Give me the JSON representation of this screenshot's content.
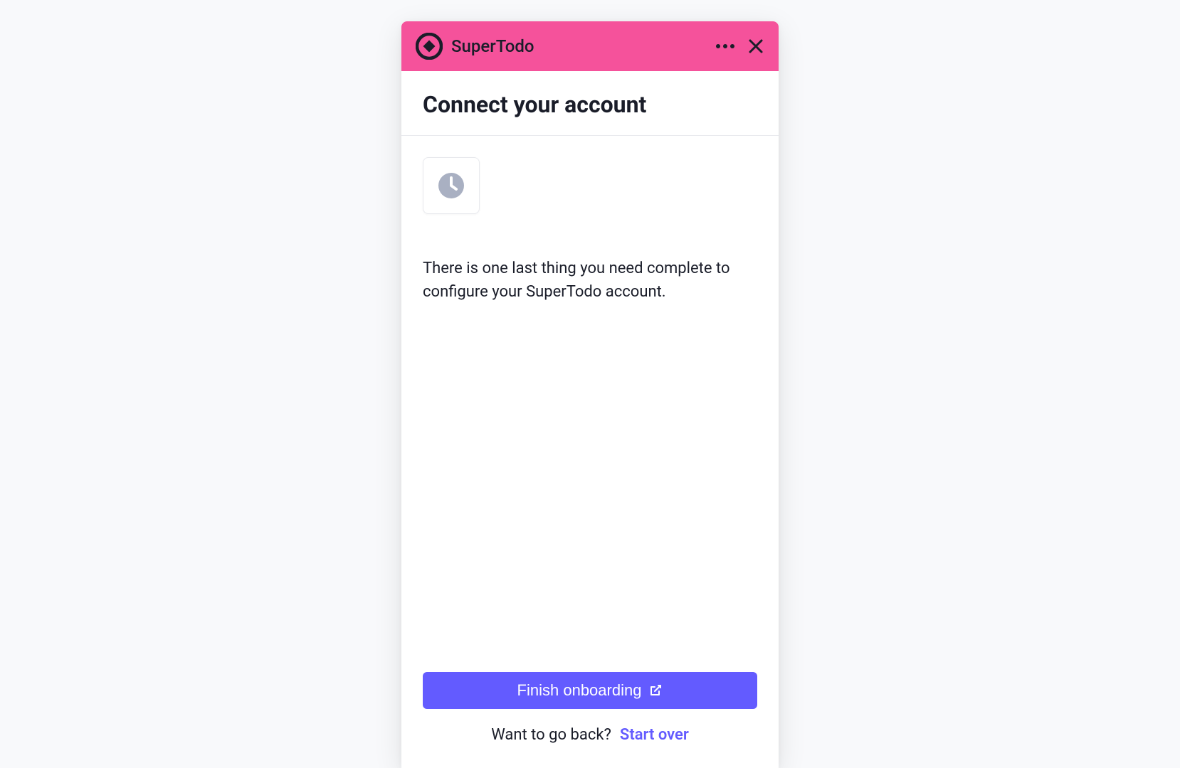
{
  "header": {
    "app_name": "SuperTodo"
  },
  "main": {
    "title": "Connect your account",
    "description": "There is one last thing you need complete to configure your SuperTodo account."
  },
  "actions": {
    "primary_button_label": "Finish onboarding",
    "footer_text": "Want to go back?",
    "start_over_label": "Start over"
  },
  "colors": {
    "accent": "#635bff",
    "header_bg": "#f5529b",
    "text_primary": "#1a1d29"
  }
}
